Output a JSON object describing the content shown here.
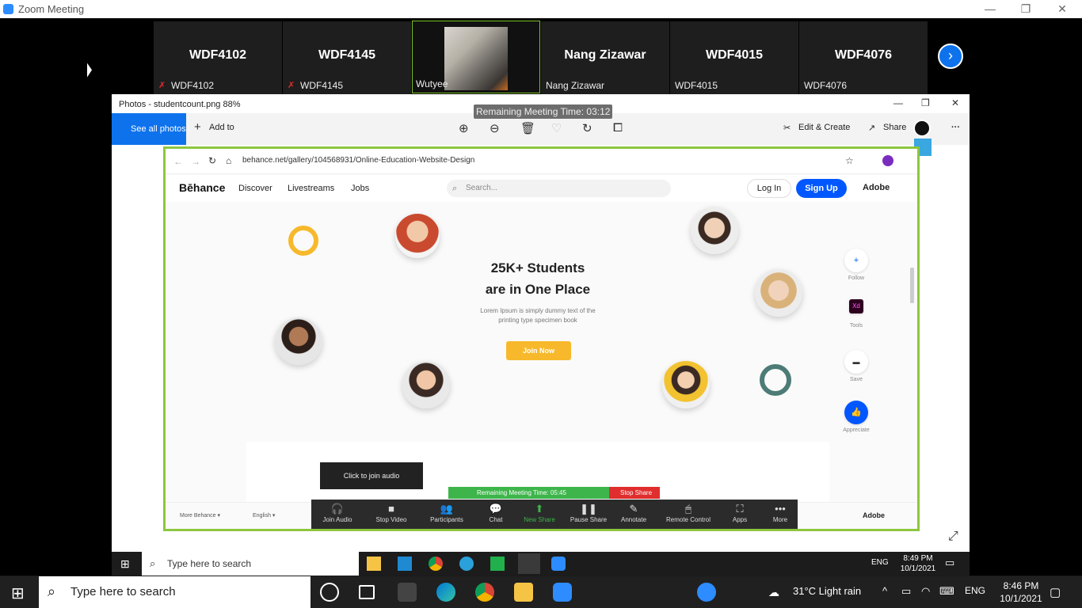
{
  "zoom": {
    "window_title": "Zoom Meeting",
    "controls": {
      "minimize": "—",
      "restore": "❐",
      "close": "✕"
    },
    "participants": [
      {
        "big": "WDF4102",
        "label": "WDF4102",
        "muted": true
      },
      {
        "big": "WDF4145",
        "label": "WDF4145",
        "muted": true
      },
      {
        "big": "",
        "label": "Wutyee",
        "muted": false,
        "has_photo": true
      },
      {
        "big": "Nang Zizawar",
        "label": "Nang Zizawar",
        "muted": false
      },
      {
        "big": "WDF4015",
        "label": "WDF4015",
        "muted": false
      },
      {
        "big": "WDF4076",
        "label": "WDF4076",
        "muted": false
      }
    ],
    "next_arrow": "›"
  },
  "photos_app": {
    "title": "Photos - studentcount.png   88%",
    "see_all": "See all photos",
    "add_to": "Add to",
    "edit_create": "Edit & Create",
    "share": "Share",
    "remaining_time_top": "Remaining Meeting Time: 03:12"
  },
  "browser": {
    "url": "behance.net/gallery/104568931/Online-Education-Website-Design",
    "nav": {
      "logo": "Bēhance",
      "links": [
        "Discover",
        "Livestreams",
        "Jobs"
      ],
      "search_placeholder": "Search...",
      "login": "Log In",
      "signup": "Sign Up",
      "adobe": "Adobe"
    },
    "hero": {
      "title_line1": "25K+ Students",
      "title_line2": "are in One Place",
      "subtitle_line1": "Lorem Ipsum is simply dummy text of the",
      "subtitle_line2": "printing type specimen book",
      "cta": "Join Now"
    },
    "rail": [
      {
        "label": "Follow",
        "icon": "+"
      },
      {
        "label": "Tools",
        "icon": "Xd"
      },
      {
        "label": "Save",
        "icon": "▬"
      },
      {
        "label": "Appreciate",
        "icon": "👍"
      }
    ],
    "footer": {
      "more": "More Behance ▾",
      "lang": "English ▾",
      "adobe": "Adobe"
    }
  },
  "zoom_overlay": {
    "join_tip": "Click to join audio",
    "remaining": "Remaining Meeting Time: 05:45",
    "stop_share": "Stop Share",
    "controls": [
      {
        "label": "Join Audio",
        "icon": "🎧"
      },
      {
        "label": "Stop Video",
        "icon": "■"
      },
      {
        "label": "Participants",
        "icon": "👥"
      },
      {
        "label": "Chat",
        "icon": "💬"
      },
      {
        "label": "New Share",
        "icon": "⬆"
      },
      {
        "label": "Pause Share",
        "icon": "❚❚"
      },
      {
        "label": "Annotate",
        "icon": "✎"
      },
      {
        "label": "Remote Control",
        "icon": "🖱"
      },
      {
        "label": "Apps",
        "icon": "⛶"
      },
      {
        "label": "More",
        "icon": "•••"
      }
    ]
  },
  "inner_taskbar": {
    "search": "Type here to search",
    "lang": "ENG",
    "time": "8:49 PM",
    "date": "10/1/2021"
  },
  "taskbar": {
    "search": "Type here to search",
    "weather": "31°C  Light rain",
    "lang": "ENG",
    "time": "8:46 PM",
    "date": "10/1/2021"
  }
}
